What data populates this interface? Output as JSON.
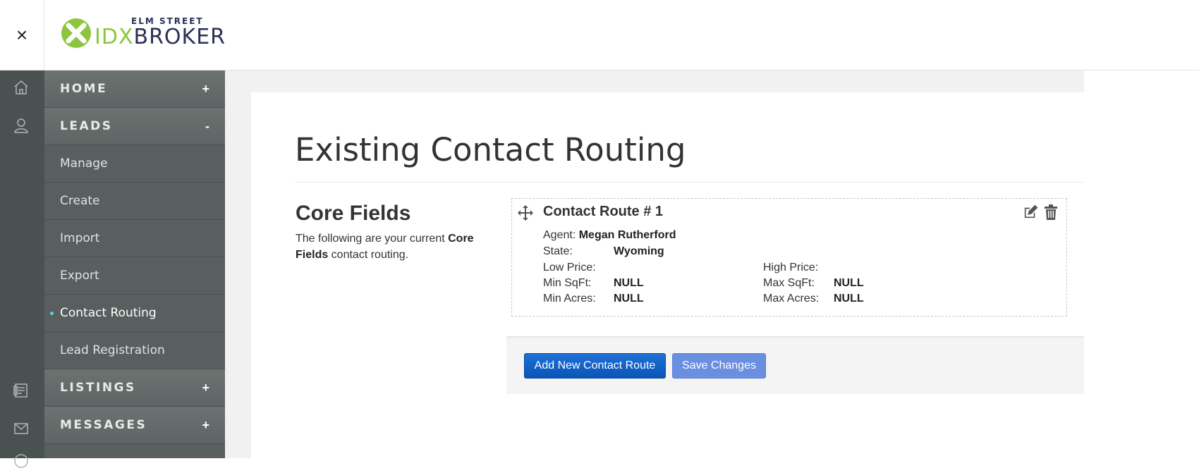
{
  "header": {
    "close_label": "×",
    "logo": {
      "top_text": "ELM STREET",
      "idx_text": "IDX",
      "broker_text": "BROKER"
    }
  },
  "rail_icons": [
    "home-icon",
    "user-icon",
    "listings-icon",
    "mail-icon",
    "help-icon"
  ],
  "nav": {
    "sections": [
      {
        "label": "HOME",
        "toggle": "+"
      },
      {
        "label": "LEADS",
        "toggle": "-"
      },
      {
        "label": "LISTINGS",
        "toggle": "+"
      },
      {
        "label": "MESSAGES",
        "toggle": "+"
      }
    ],
    "lead_items": [
      "Manage",
      "Create",
      "Import",
      "Export",
      "Contact Routing",
      "Lead Registration"
    ],
    "active_item": "Contact Routing"
  },
  "page": {
    "title": "Existing Contact Routing",
    "section_title": "Core Fields",
    "section_desc_prefix": "The following are your current ",
    "section_desc_bold": "Core Fields",
    "section_desc_suffix": " contact routing."
  },
  "route": {
    "title": "Contact Route # 1",
    "agent_label": "Agent:",
    "agent_value": "Megan Rutherford",
    "state_label": "State:",
    "state_value": "Wyoming",
    "low_price_label": "Low Price:",
    "low_price_value": "",
    "high_price_label": "High Price:",
    "high_price_value": "",
    "min_sqft_label": "Min SqFt:",
    "min_sqft_value": "NULL",
    "max_sqft_label": "Max SqFt:",
    "max_sqft_value": "NULL",
    "min_acres_label": "Min Acres:",
    "min_acres_value": "NULL",
    "max_acres_label": "Max Acres:",
    "max_acres_value": "NULL"
  },
  "actions": {
    "add_label": "Add New Contact Route",
    "save_label": "Save Changes"
  },
  "colors": {
    "rail": "#4a5251",
    "nav": "#585f5e",
    "brand_green": "#8cc63f",
    "brand_navy": "#2e2f57",
    "primary_button": "#0a55b8",
    "secondary_button": "#6b8fe0",
    "active_dot": "#5ad0e8"
  }
}
